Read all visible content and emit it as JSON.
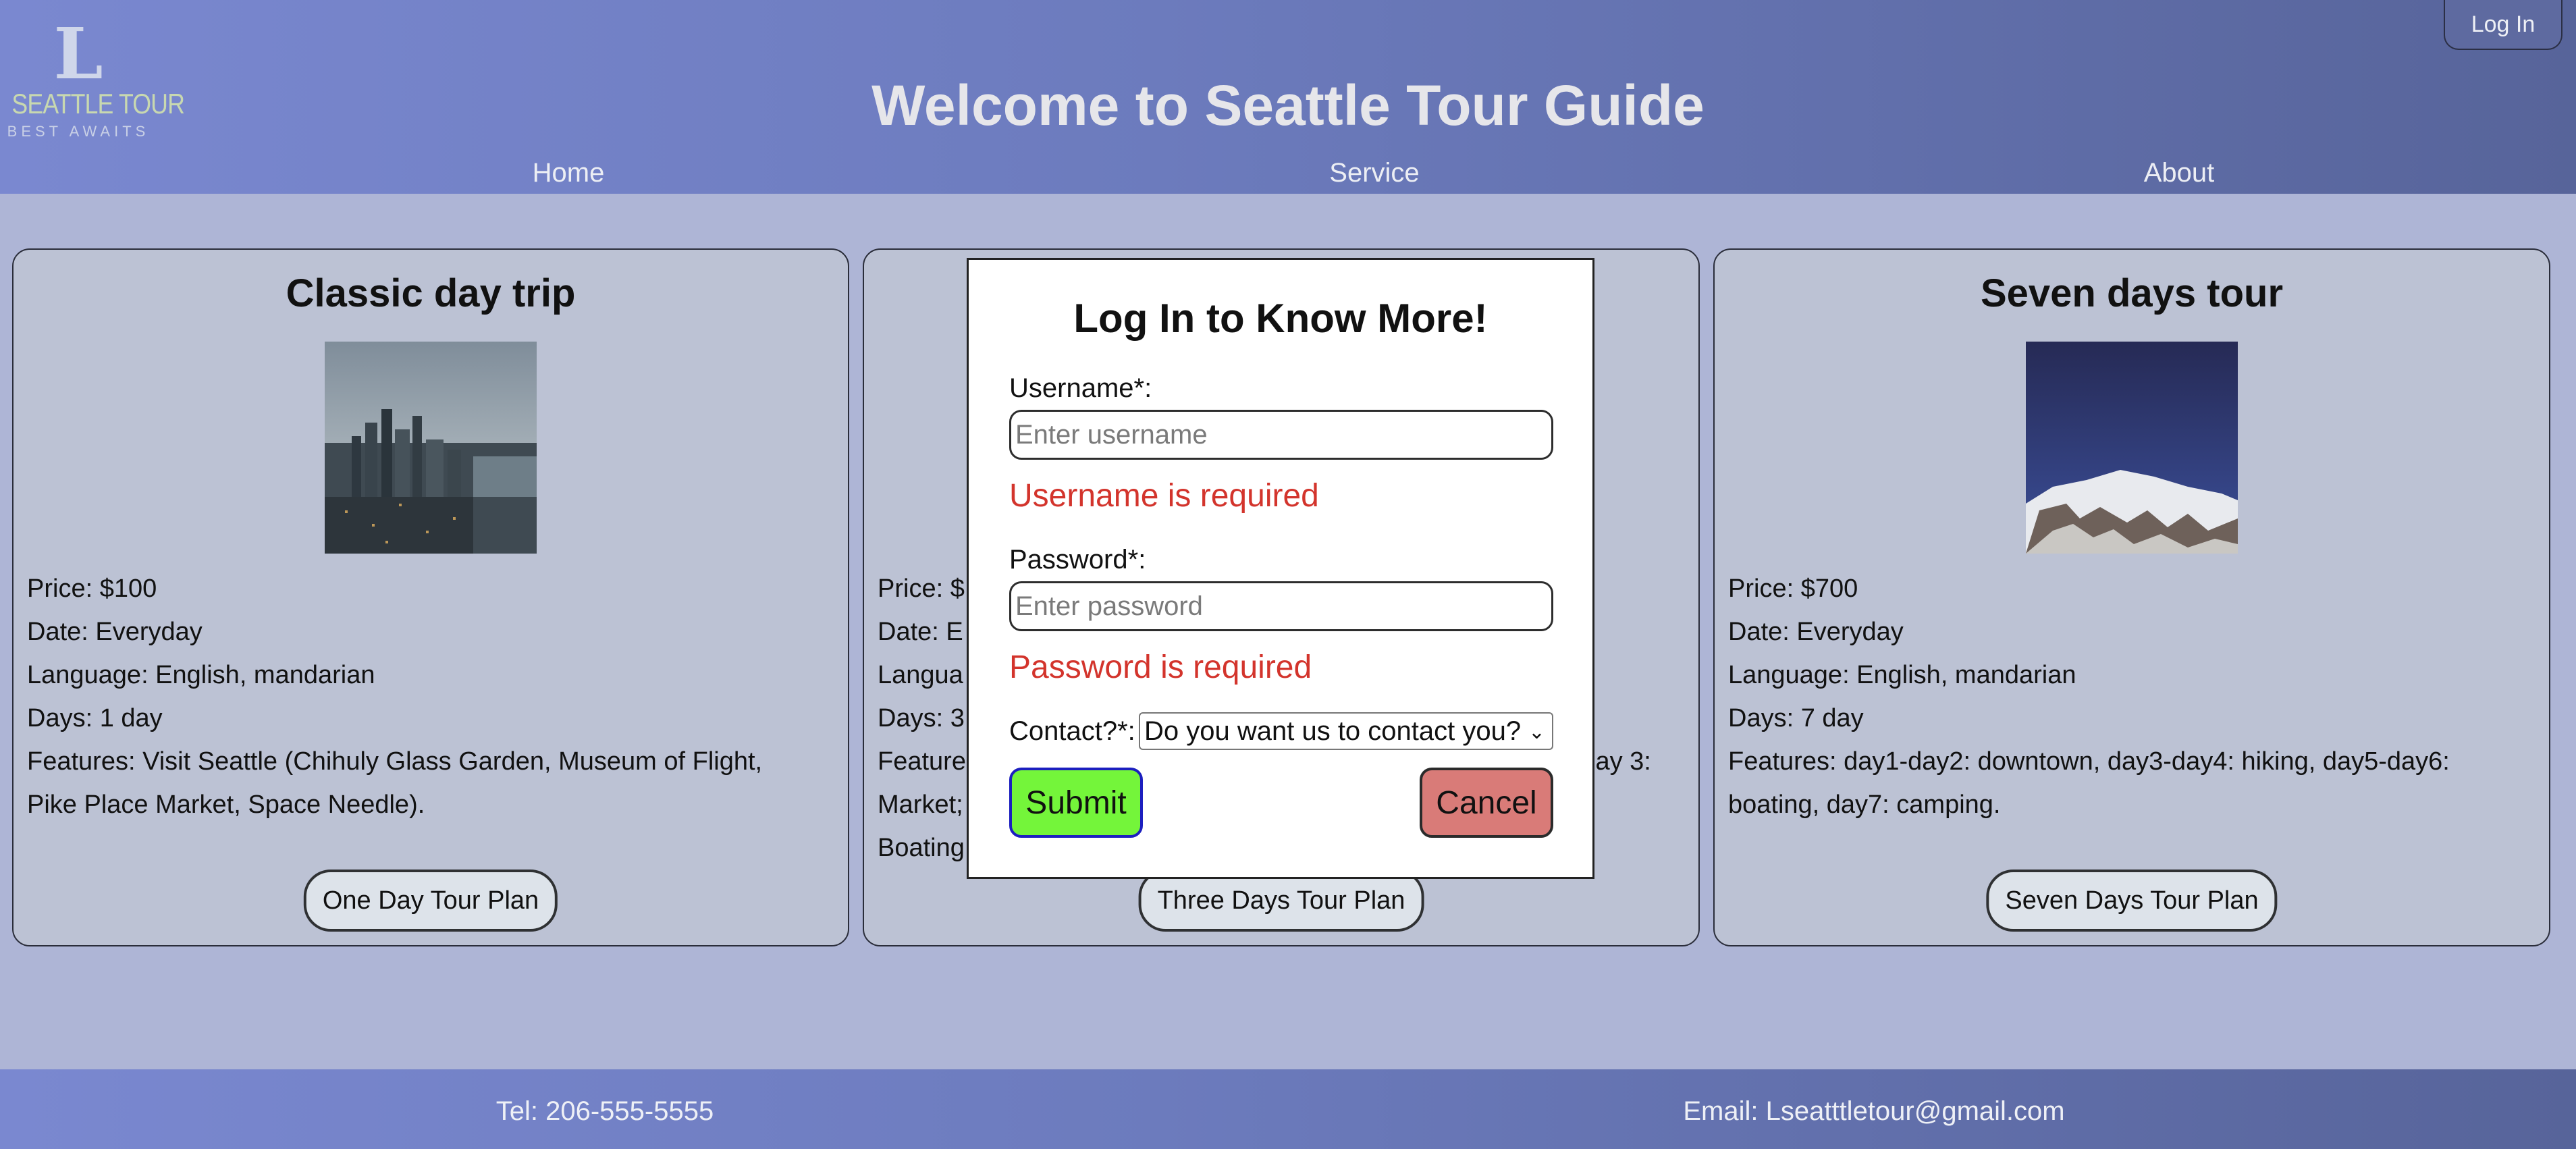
{
  "header": {
    "logo": {
      "letter": "L",
      "name": "SEATTLE TOUR",
      "tagline": "BEST AWAITS"
    },
    "title": "Welcome to Seattle Tour Guide",
    "nav": [
      "Home",
      "Service",
      "About"
    ],
    "login_label": "Log In"
  },
  "cards": [
    {
      "title": "Classic day trip",
      "image_icon": "seattle-skyline-photo",
      "lines": [
        "Price: $100",
        "Date: Everyday",
        "Language: English, mandarian",
        "Days: 1 day",
        "Features: Visit Seattle (Chihuly Glass Garden, Museum of Flight,",
        "Pike Place Market, Space Needle)."
      ],
      "button": "One Day Tour Plan"
    },
    {
      "title": "",
      "lines": [
        "Price: $",
        "Date: E",
        "Langua",
        "Days: 3",
        "Feature",
        "Market;",
        "Boating"
      ],
      "tail": "Day 3:",
      "button": "Three Days Tour Plan"
    },
    {
      "title": "Seven days tour",
      "image_icon": "mountain-photo",
      "lines": [
        "Price: $700",
        "Date: Everyday",
        "Language: English, mandarian",
        "Days: 7 day",
        "Features: day1-day2: downtown, day3-day4: hiking, day5-day6:",
        "boating, day7: camping."
      ],
      "button": "Seven Days Tour Plan"
    }
  ],
  "modal": {
    "title": "Log In to Know More!",
    "username_label": "Username*:",
    "username_placeholder": "Enter username",
    "username_error": "Username is required",
    "password_label": "Password*:",
    "password_placeholder": "Enter password",
    "password_error": "Password is required",
    "contact_label": "Contact?*:",
    "contact_selected": "Do you want us to contact you?",
    "submit_label": "Submit",
    "cancel_label": "Cancel"
  },
  "footer": {
    "tel": "Tel: 206-555-5555",
    "email": "Email: Lseatttletour@gmail.com"
  },
  "colors": {
    "header_start": "#7a88d0",
    "header_end": "#57649a",
    "page_bg": "#aeb5d6",
    "card_bg": "#bcc2d4",
    "error": "#d3342c",
    "submit_bg": "#74f53a",
    "cancel_bg": "#d97b78"
  }
}
